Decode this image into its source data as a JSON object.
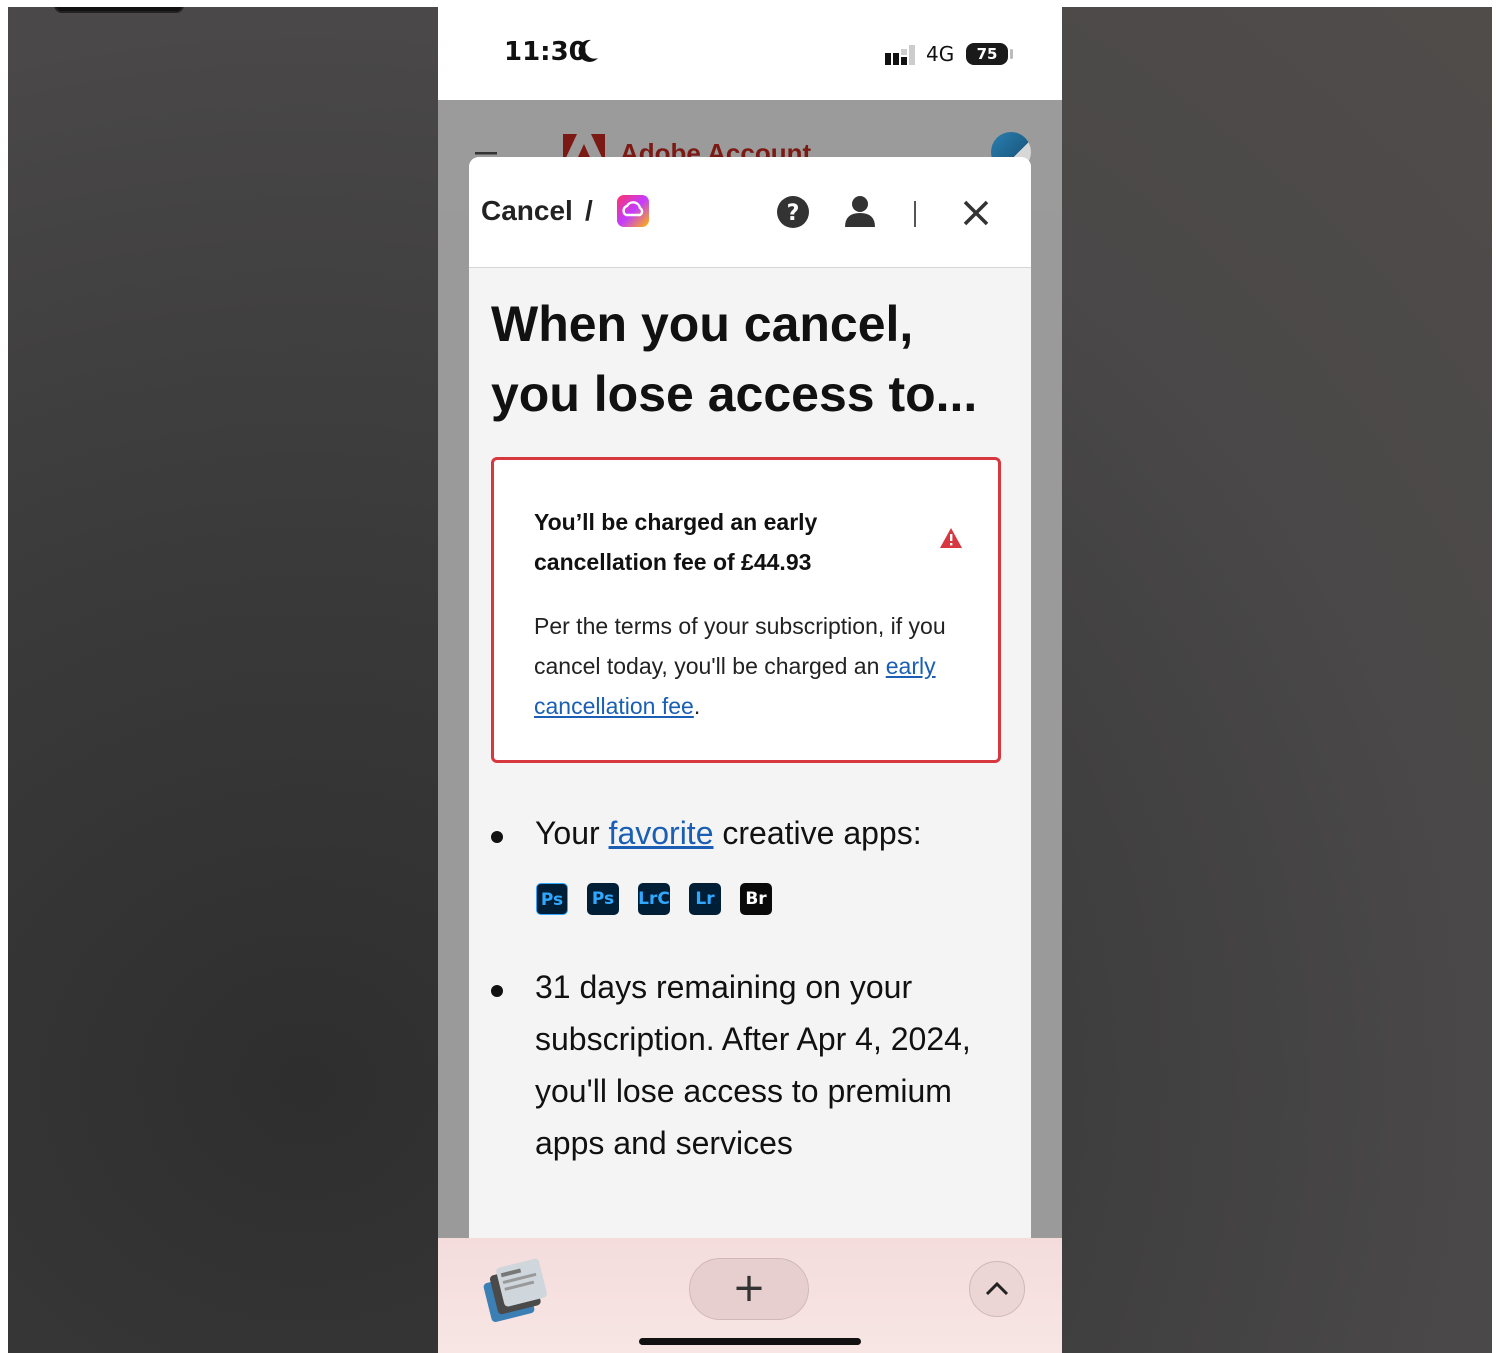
{
  "status_bar": {
    "time": "11:30",
    "network": "4G",
    "battery": "75"
  },
  "site_header": {
    "title": "Adobe Account"
  },
  "modal": {
    "breadcrumb_cancel": "Cancel",
    "breadcrumb_separator": "/",
    "headline": "When you cancel, you lose access to...",
    "warning": {
      "title": "You’ll be charged an early cancellation fee of £44.93",
      "desc_before": "Per the terms of your subscription, if you cancel today, you'll be charged an ",
      "desc_link": "early cancellation fee",
      "desc_after": "."
    },
    "bullets": {
      "apps_prefix": "Your ",
      "apps_link": "favorite",
      "apps_suffix": " creative apps:",
      "apps": [
        "Ps",
        "Ps",
        "LrC",
        "Lr",
        "Br"
      ],
      "remaining": "31 days remaining on your subscription. After Apr 4, 2024, you'll lose access to premium apps and services"
    }
  },
  "browser_bar": {
    "new_tab": "+"
  },
  "colors": {
    "adobe_red": "#d7373f",
    "link_blue": "#1a5fb4",
    "adobe_brand": "#fa0f00"
  }
}
